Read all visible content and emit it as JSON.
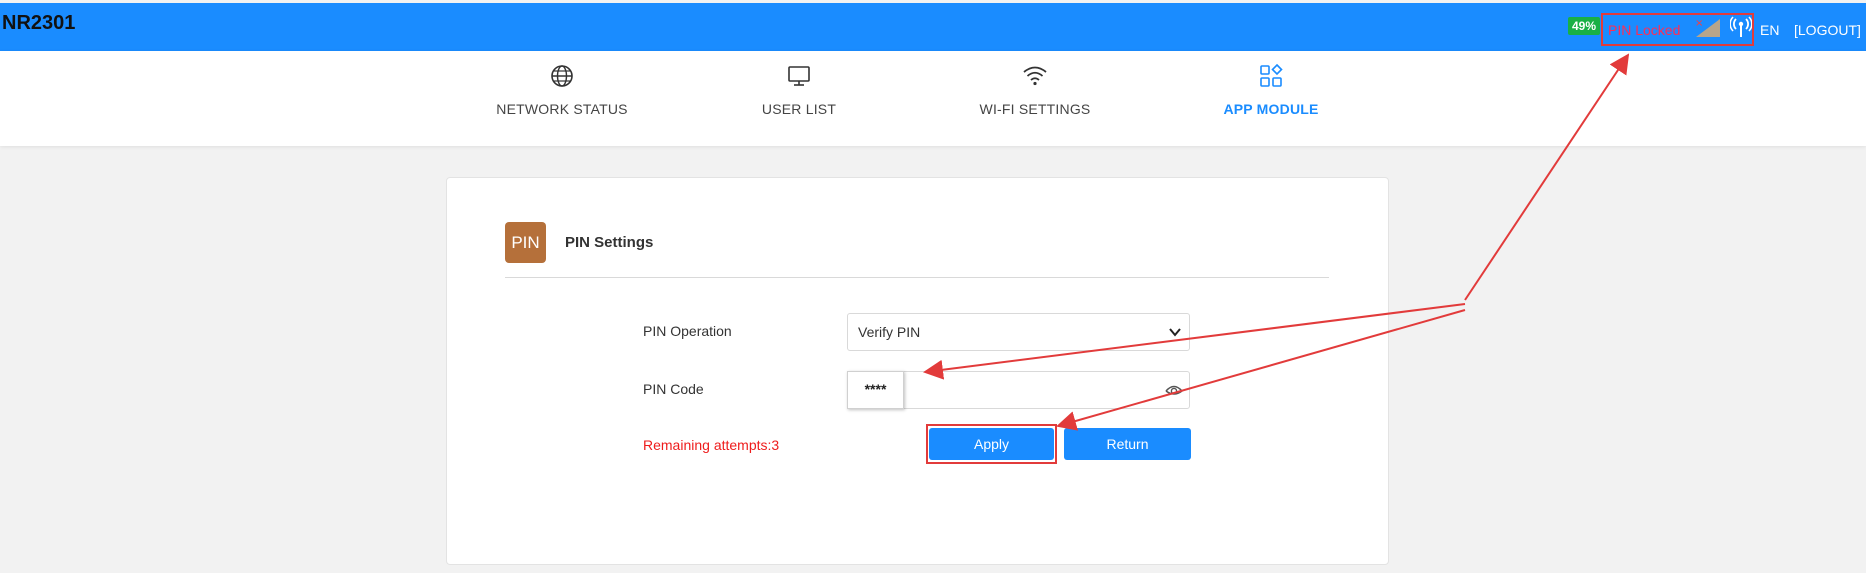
{
  "header": {
    "brand": "NR2301",
    "battery": "49%",
    "pin_status": "PIN Locked",
    "language": "EN",
    "logout": "[LOGOUT]"
  },
  "nav": {
    "items": [
      {
        "label": "NETWORK STATUS",
        "icon": "globe-icon"
      },
      {
        "label": "USER LIST",
        "icon": "monitor-icon"
      },
      {
        "label": "WI-FI SETTINGS",
        "icon": "wifi-icon"
      },
      {
        "label": "APP MODULE",
        "icon": "apps-icon",
        "active": true
      }
    ]
  },
  "card": {
    "badge": "PIN",
    "title": "PIN Settings",
    "pin_operation_label": "PIN Operation",
    "pin_operation_value": "Verify PIN",
    "pin_code_label": "PIN Code",
    "pin_code_value": "****",
    "remaining": "Remaining attempts:3",
    "apply_label": "Apply",
    "return_label": "Return"
  },
  "colors": {
    "header_bg": "#1a8cff",
    "accent": "#1a8cff",
    "battery": "#19b045",
    "pin_badge": "#b5703a",
    "warning": "#ee1c1c",
    "annotation": "#e23b3b"
  }
}
